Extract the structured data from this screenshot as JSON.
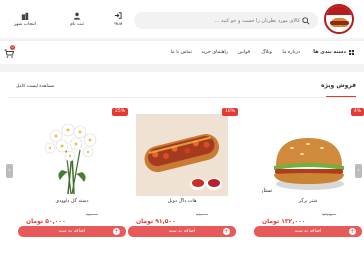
{
  "header": {
    "search_placeholder": "کالای مورد نظرتان را جست و جو کنید ...",
    "login_label": "ورود",
    "profile_label": "ثبت نام",
    "city_label": "انتخاب شهر"
  },
  "nav": {
    "categories_label": "دسته بندی ها",
    "links": [
      "درباره ما",
      "وبلاگ",
      "قوانین",
      "راهنمای خرید",
      "تماس با ما"
    ],
    "cart_count": "0"
  },
  "special": {
    "title": "فروش ویژه",
    "view_all": "مشاهده لیست کامل",
    "add_label": "اضافه به سبد",
    "currency": "تومان",
    "products": [
      {
        "name": "شتر برگر",
        "discount": "4%",
        "old_price": "۱۳۷,۵۰۰",
        "price": "۱۳۲,۰۰۰"
      },
      {
        "name": "هات داگ دوبل",
        "discount": "10%",
        "old_price": "۹۹,۰۰۰",
        "price": "۹۱,۵۰۰"
      },
      {
        "name": "دسته گل داوودی",
        "discount": "25%",
        "old_price": "۶۸,۰۰۰",
        "price": "۵۰,۰۰۰"
      }
    ]
  },
  "colors": {
    "accent": "#e53935",
    "button": "#e85a5a"
  }
}
